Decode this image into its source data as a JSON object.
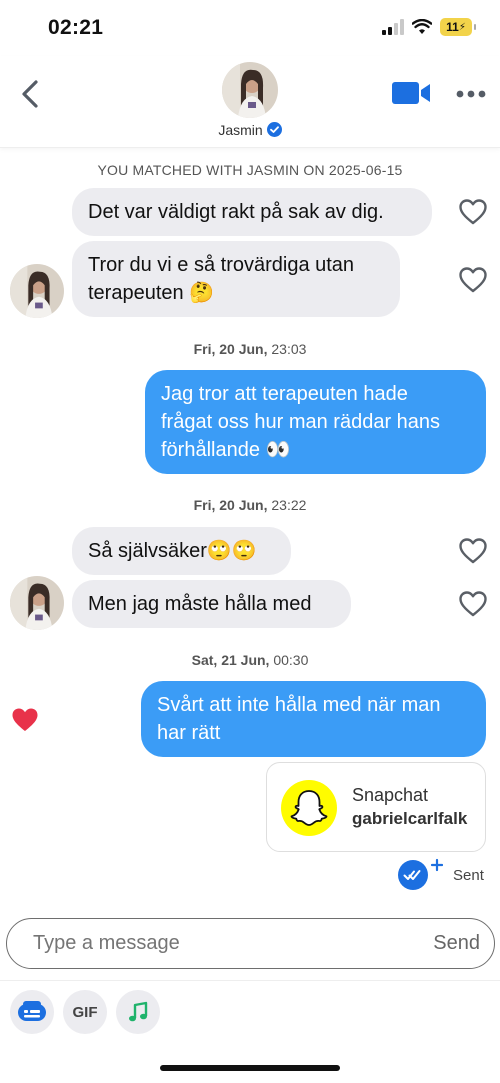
{
  "status_bar": {
    "time": "02:21",
    "battery": "11"
  },
  "header": {
    "contact_name": "Jasmin"
  },
  "match_banner": "YOU MATCHED WITH JASMIN ON 2025-06-15",
  "messages": [
    {
      "text": "Det var väldigt rakt på sak av dig."
    },
    {
      "line1": "Tror du vi e så trovärdiga utan",
      "line2": "terapeuten 🤔"
    },
    {
      "day": "Fri, 20 Jun,",
      "time": "23:03"
    },
    {
      "line1": "Jag tror att terapeuten hade",
      "line2": "frågat oss hur man räddar hans",
      "line3": "förhållande 👀"
    },
    {
      "day": "Fri, 20 Jun,",
      "time": "23:22"
    },
    {
      "text": "Så självsäker🙄🙄"
    },
    {
      "text": "Men jag måste hålla med"
    },
    {
      "day": "Sat, 21 Jun,",
      "time": "00:30"
    },
    {
      "line1": "Svårt att inte hålla med när man",
      "line2": "har rätt"
    }
  ],
  "snap_card": {
    "title": "Snapchat",
    "username": "gabrielcarlfalk"
  },
  "sent_status": "Sent",
  "composer": {
    "placeholder": "Type a message",
    "send_label": "Send"
  },
  "toolbar": {
    "gif_label": "GIF"
  },
  "colors": {
    "outgoing_bubble": "#3b9cf6",
    "incoming_bubble": "#ececf0",
    "accent": "#1c6fe0",
    "like_heart": "#e8324a",
    "snap_yellow": "#fffc00"
  }
}
